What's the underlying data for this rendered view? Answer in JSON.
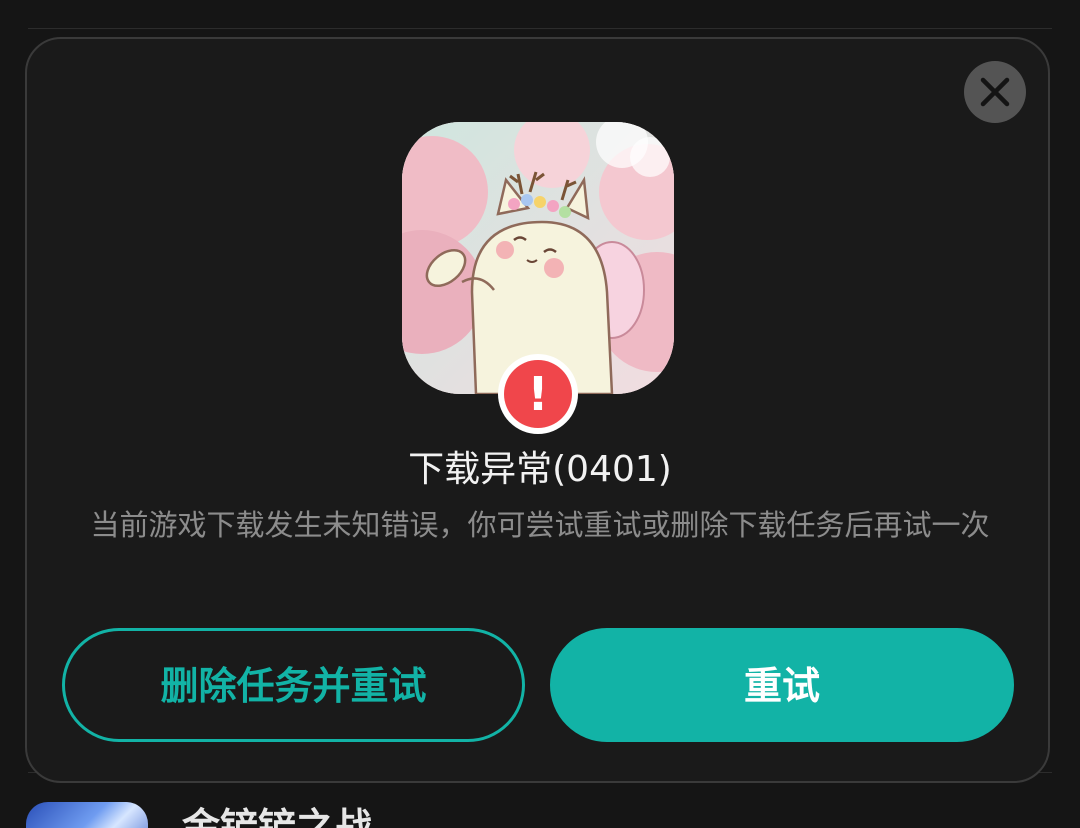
{
  "dialog": {
    "title": "下载异常(0401)",
    "description": "当前游戏下载发生未知错误，你可尝试重试或删除下载任务后再试一次",
    "error_mark": "!",
    "buttons": {
      "delete_and_retry": "删除任务并重试",
      "retry": "重试"
    }
  },
  "background": {
    "next_app_title_partial": "金铲铲之战"
  },
  "icons": {
    "close": "close-icon",
    "error": "error-icon",
    "game": "game-icon"
  },
  "colors": {
    "accent": "#12b3a6",
    "error": "#f0464b",
    "dialog_bg": "#1a1a1a",
    "page_bg": "#151515"
  }
}
